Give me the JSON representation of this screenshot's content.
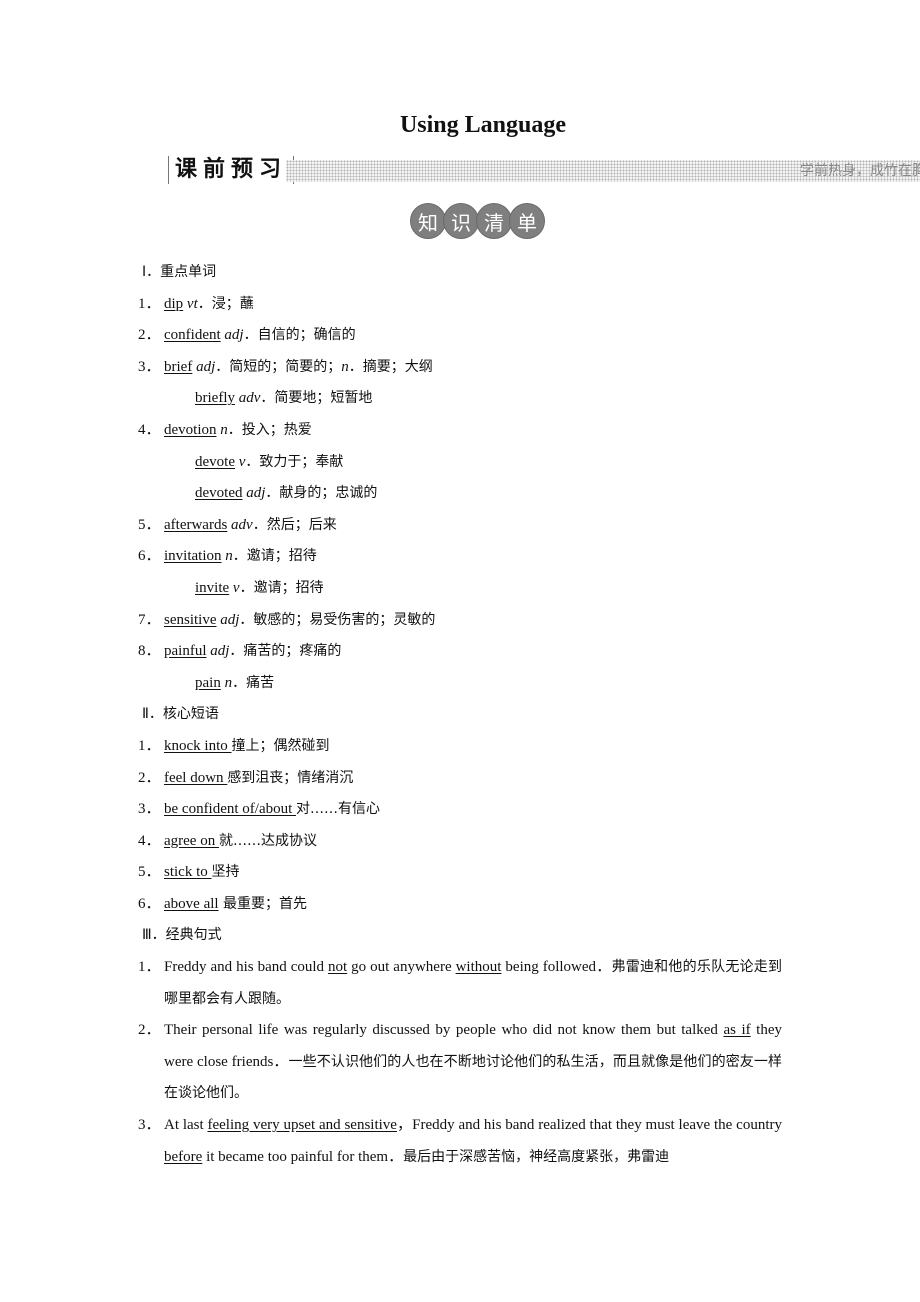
{
  "page_title": "Using Language",
  "banner": {
    "label": "课前预习",
    "slogan": "学前热身，成竹在胸"
  },
  "badge": [
    "知",
    "识",
    "清",
    "单"
  ],
  "sections": {
    "words": {
      "heading": "Ⅰ．重点单词",
      "items": [
        {
          "num": "1．",
          "word": "dip",
          "pos": "vt",
          "meaning": "．浸；蘸"
        },
        {
          "num": "2．",
          "word": "confident",
          "pos": "adj",
          "meaning": "．自信的；确信的"
        },
        {
          "num": "3．",
          "word": "brief",
          "pos": "adj",
          "meaning": "．简短的；简要的；",
          "pos2": "n",
          "meaning2": "．摘要；大纲"
        },
        {
          "num": "",
          "word": "briefly",
          "pos": "adv",
          "meaning": "．简要地；短暂地"
        },
        {
          "num": "4．",
          "word": "devotion",
          "pos": "n",
          "meaning": "．投入；热爱"
        },
        {
          "num": "",
          "word": "devote",
          "pos": "v",
          "meaning": "．致力于；奉献"
        },
        {
          "num": "",
          "word": "devoted",
          "pos": "adj",
          "meaning": "．献身的；忠诚的"
        },
        {
          "num": "5．",
          "word": "afterwards",
          "pos": "adv",
          "meaning": "．然后；后来"
        },
        {
          "num": "6．",
          "word": "invitation",
          "pos": "n",
          "meaning": "．邀请；招待"
        },
        {
          "num": "",
          "word": "invite",
          "pos": "v",
          "meaning": "．邀请；招待"
        },
        {
          "num": "7．",
          "word": "sensitive",
          "pos": "adj",
          "meaning": "．敏感的；易受伤害的；灵敏的"
        },
        {
          "num": "8．",
          "word": "painful",
          "pos": "adj",
          "meaning": "．痛苦的；疼痛的"
        },
        {
          "num": "",
          "word": "pain",
          "pos": "n",
          "meaning": "．痛苦"
        }
      ]
    },
    "phrases": {
      "heading": "Ⅱ．核心短语",
      "items": [
        {
          "num": "1．",
          "phrase": "knock into ",
          "meaning": "撞上；偶然碰到"
        },
        {
          "num": "2．",
          "phrase": "feel down ",
          "meaning": "感到沮丧；情绪消沉"
        },
        {
          "num": "3．",
          "phrase": "be confident of/about ",
          "meaning": "对……有信心"
        },
        {
          "num": "4．",
          "phrase": "agree on ",
          "meaning": "就……达成协议"
        },
        {
          "num": "5．",
          "phrase": "stick to ",
          "meaning": "坚持"
        },
        {
          "num": "6．",
          "phrase": "above all",
          "meaning": " 最重要；首先"
        }
      ]
    },
    "sentences": {
      "heading": "Ⅲ．经典句式",
      "items": [
        {
          "num": "1．",
          "parts": [
            {
              "t": "Freddy and his band could "
            },
            {
              "t": "not",
              "u": true
            },
            {
              "t": " go out anywhere "
            },
            {
              "t": "without",
              "u": true
            },
            {
              "t": " being followed．"
            },
            {
              "t": "弗雷迪和他的乐队无论走到哪里都会有人跟随。",
              "cn": true
            }
          ]
        },
        {
          "num": "2．",
          "parts": [
            {
              "t": "Their personal life was regularly discussed by people who did not know them but talked "
            },
            {
              "t": "as if",
              "u": true
            },
            {
              "t": " they were close friends．"
            },
            {
              "t": "一些不认识他们的人也在不断地讨论他们的私生活，而且就像是他们的密友一样在谈论他们。",
              "cn": true
            }
          ]
        },
        {
          "num": "3．",
          "parts": [
            {
              "t": "At last "
            },
            {
              "t": "feeling very upset and sensitive",
              "u": true
            },
            {
              "t": "，Freddy and his band realized that they must leave the country "
            },
            {
              "t": "before",
              "u": true
            },
            {
              "t": " it became too painful for them．"
            },
            {
              "t": "最后由于深感苦恼，神经高度紧张，弗雷迪",
              "cn": true
            }
          ]
        }
      ]
    }
  }
}
